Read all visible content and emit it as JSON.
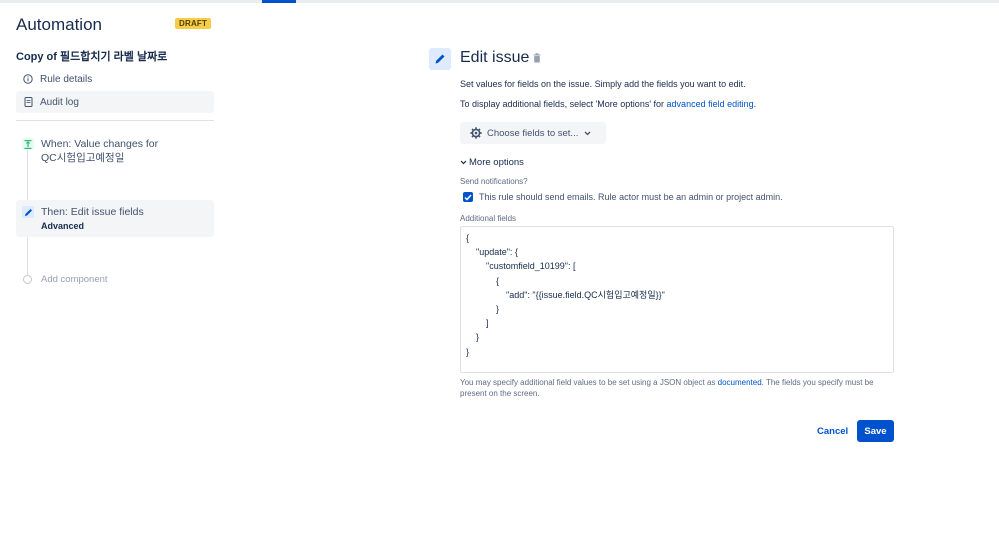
{
  "app": {
    "title": "Automation",
    "status_badge": "DRAFT",
    "rule_name": "Copy of 필드합치기 라벨 날짜로"
  },
  "sidebar": {
    "nav_items": [
      {
        "label": "Rule details",
        "icon": "info-icon"
      },
      {
        "label": "Audit log",
        "icon": "document-icon"
      }
    ],
    "components": [
      {
        "label": "When: Value changes for",
        "sub": "QC시험입고예정일",
        "icon": "trigger-icon",
        "icon_color": "#36b37e"
      },
      {
        "label": "Then: Edit issue fields",
        "sub": "Advanced",
        "icon": "pencil-icon",
        "icon_color": "#0052cc"
      }
    ],
    "add_component": "Add component"
  },
  "main": {
    "title": "Edit issue",
    "desc1": "Set values for fields on the issue. Simply add the fields you want to edit.",
    "desc2_prefix": "To display additional fields, select 'More options' for ",
    "desc2_link": "advanced field editing",
    "desc2_suffix": ".",
    "choose_fields": "Choose fields to set...",
    "more_options": "More options",
    "send_notifications_label": "Send notifications?",
    "send_notifications_checked": true,
    "send_notifications_text": "This rule should send emails. Rule actor must be an admin or project admin.",
    "additional_fields_label": "Additional fields",
    "json_lines": [
      "{",
      "    \"update\": {",
      "        \"customfield_10199\": [",
      "            {",
      "                \"add\": \"{{issue.field.QC시험입고예정일}}\"",
      "            }",
      "        ]",
      "    }",
      "}"
    ],
    "help_prefix": "You may specify additional field values to be set using a JSON object as ",
    "help_link": "documented",
    "help_suffix": ". The fields you specify must be present on the screen.",
    "cancel": "Cancel",
    "save": "Save"
  },
  "colors": {
    "primary": "#0052cc",
    "draft": "#f5cd47",
    "trigger": "#36b37e",
    "spellcheck": "#de350b"
  }
}
